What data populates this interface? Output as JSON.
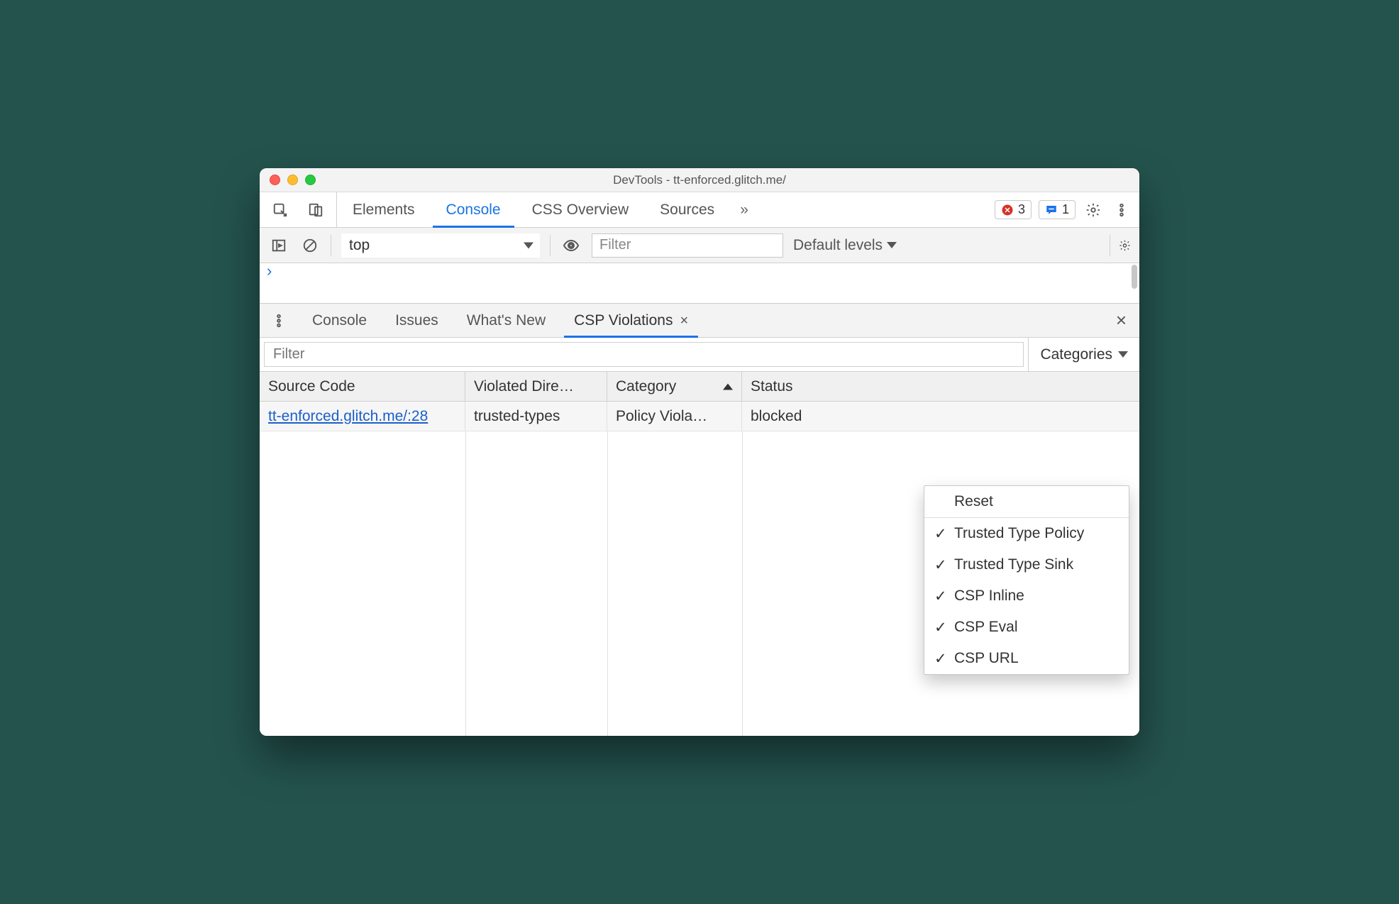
{
  "title": "DevTools - tt-enforced.glitch.me/",
  "mainTabs": {
    "items": [
      "Elements",
      "Console",
      "CSS Overview",
      "Sources"
    ],
    "active": "Console",
    "overflow": "»",
    "errorCount": "3",
    "messageCount": "1"
  },
  "consoleToolbar": {
    "context": "top",
    "filterPlaceholder": "Filter",
    "levels": "Default levels"
  },
  "drawerTabs": {
    "items": [
      "Console",
      "Issues",
      "What's New",
      "CSP Violations"
    ],
    "active": "CSP Violations"
  },
  "csp": {
    "filterPlaceholder": "Filter",
    "categoriesLabel": "Categories",
    "columns": {
      "source": "Source Code",
      "directive": "Violated Dire…",
      "category": "Category",
      "status": "Status"
    },
    "rows": [
      {
        "source": "tt-enforced.glitch.me/:28",
        "directive": "trusted-types",
        "category": "Policy Viola…",
        "status": "blocked"
      }
    ],
    "dropdown": {
      "reset": "Reset",
      "options": [
        "Trusted Type Policy",
        "Trusted Type Sink",
        "CSP Inline",
        "CSP Eval",
        "CSP URL"
      ]
    }
  }
}
